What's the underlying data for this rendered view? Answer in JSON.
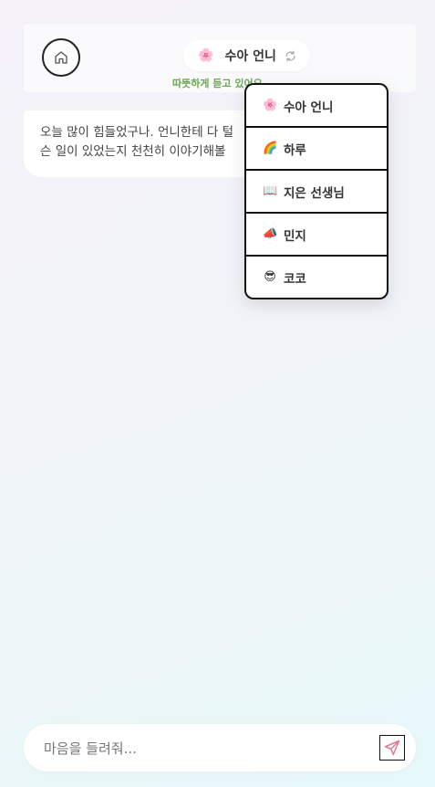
{
  "header": {
    "persona": {
      "emoji": "🌸",
      "name": "수아 언니"
    },
    "status": "따뜻하게 듣고 있어요"
  },
  "chat": {
    "messages": [
      {
        "line1": "오늘 많이 힘들었구나. 언니한테 다 털",
        "line2": "슨 일이 있었는지 천천히 이야기해볼"
      }
    ]
  },
  "persona_menu": {
    "items": [
      {
        "emoji": "🌸",
        "label": "수아 언니"
      },
      {
        "emoji": "🌈",
        "label": "하루"
      },
      {
        "emoji": "📖",
        "label": "지은 선생님"
      },
      {
        "emoji": "📣",
        "label": "민지"
      },
      {
        "emoji": "😎",
        "label": "코코"
      }
    ]
  },
  "composer": {
    "placeholder": "마음을 들려줘..."
  },
  "colors": {
    "status": "#6aa84f",
    "send_icon": "#e07a93"
  }
}
